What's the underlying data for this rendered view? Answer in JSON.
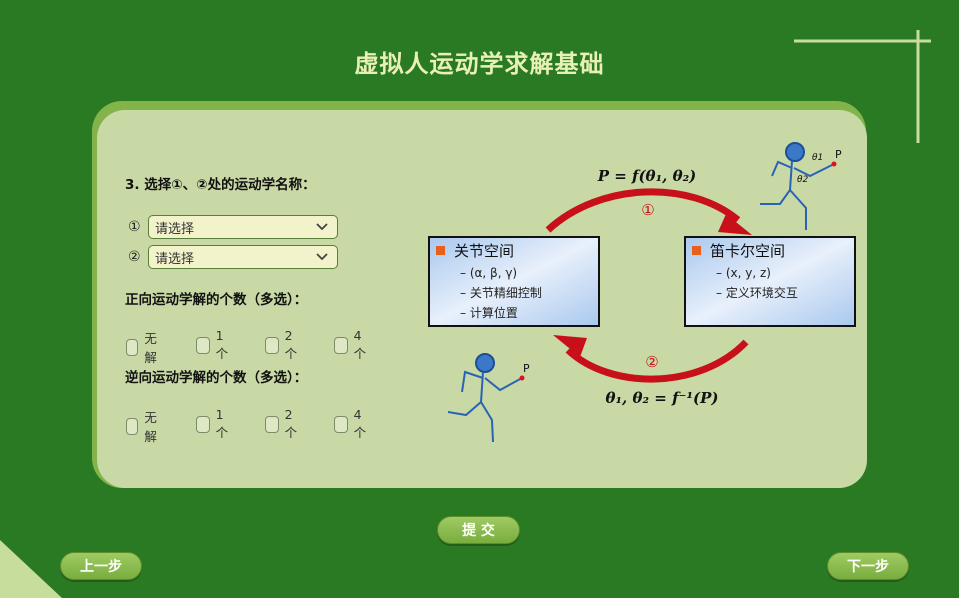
{
  "page": {
    "title": "虚拟人运动学求解基础"
  },
  "question": {
    "title": "3. 选择①、②处的运动学名称：",
    "selects": [
      {
        "marker": "①",
        "value": "请选择"
      },
      {
        "marker": "②",
        "value": "请选择"
      }
    ],
    "forward_title": "正向运动学解的个数（多选）：",
    "forward_options": [
      "无解",
      "1个",
      "2个",
      "4个"
    ],
    "inverse_title": "逆向运动学解的个数（多选）：",
    "inverse_options": [
      "无解",
      "1个",
      "2个",
      "4个"
    ]
  },
  "diagram": {
    "joint_space": {
      "title": "关节空间",
      "items": [
        "–  (α, β, γ)",
        "–  关节精细控制",
        "–  计算位置"
      ]
    },
    "cartesian_space": {
      "title": "笛卡尔空间",
      "items": [
        "–  (x, y, z)",
        "–  定义环境交互"
      ]
    },
    "forward_formula": "P = f(θ₁, θ₂)",
    "inverse_formula": "θ₁, θ₂ = f⁻¹(P)",
    "marker_1": "①",
    "marker_2": "②",
    "figure_labels": {
      "theta1": "θ1",
      "theta2": "θ2",
      "point": "P"
    },
    "arrow_color": "#c8101a"
  },
  "buttons": {
    "submit": "提 交",
    "prev": "上一步",
    "next": "下一步"
  },
  "colors": {
    "background": "#2a7a23",
    "panel": "#c8d9a6",
    "title": "#e9f0b4",
    "button": "#8bbd50"
  },
  "icons": [
    "chevron-down-icon",
    "checkbox-icon",
    "stick-figure-icon",
    "bullet-square-icon"
  ]
}
